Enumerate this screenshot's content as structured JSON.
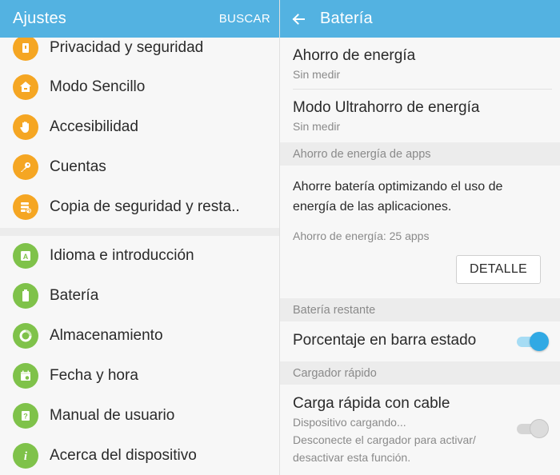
{
  "left": {
    "appbar": {
      "title": "Ajustes",
      "search_label": "BUSCAR"
    },
    "items": [
      {
        "label": "Privacidad y seguridad",
        "icon": "privacy-icon",
        "color": "#f5a623"
      },
      {
        "label": "Modo Sencillo",
        "icon": "home-icon",
        "color": "#f5a623"
      },
      {
        "label": "Accesibilidad",
        "icon": "hand-icon",
        "color": "#f5a623"
      },
      {
        "label": "Cuentas",
        "icon": "key-icon",
        "color": "#f5a623"
      },
      {
        "label": "Copia de seguridad y resta..",
        "icon": "backup-icon",
        "color": "#f5a623"
      },
      {
        "label": "Idioma e introducción",
        "icon": "language-icon",
        "color": "#7fc24a"
      },
      {
        "label": "Batería",
        "icon": "battery-icon",
        "color": "#7fc24a"
      },
      {
        "label": "Almacenamiento",
        "icon": "storage-icon",
        "color": "#7fc24a"
      },
      {
        "label": "Fecha y hora",
        "icon": "calendar-icon",
        "color": "#7fc24a"
      },
      {
        "label": "Manual de usuario",
        "icon": "manual-icon",
        "color": "#7fc24a"
      },
      {
        "label": "Acerca del dispositivo",
        "icon": "info-icon",
        "color": "#7fc24a"
      }
    ]
  },
  "right": {
    "appbar": {
      "title": "Batería"
    },
    "power_saving": {
      "title": "Ahorro de energía",
      "subtitle": "Sin medir"
    },
    "ultra_power_saving": {
      "title": "Modo Ultrahorro de energía",
      "subtitle": "Sin medir"
    },
    "app_saving_section": "Ahorro de energía de apps",
    "app_saving_description": "Ahorre batería optimizando el uso de energía de las aplicaciones.",
    "app_saving_status": "Ahorro de energía: 25 apps",
    "detail_button": "DETALLE",
    "remaining_section": "Batería restante",
    "percentage": {
      "title": "Porcentaje en barra estado",
      "enabled": true
    },
    "fast_charge_section": "Cargador rápido",
    "fast_cable": {
      "title": "Carga rápida con cable",
      "subtitle": "Dispositivo cargando...",
      "description_line1": "Desconecte el cargador para activar/",
      "description_line2": "desactivar esta función.",
      "enabled": false
    }
  },
  "colors": {
    "appbar": "#53b2e1",
    "orange": "#f5a623",
    "green": "#7fc24a",
    "switch_on": "#31a9e4"
  }
}
